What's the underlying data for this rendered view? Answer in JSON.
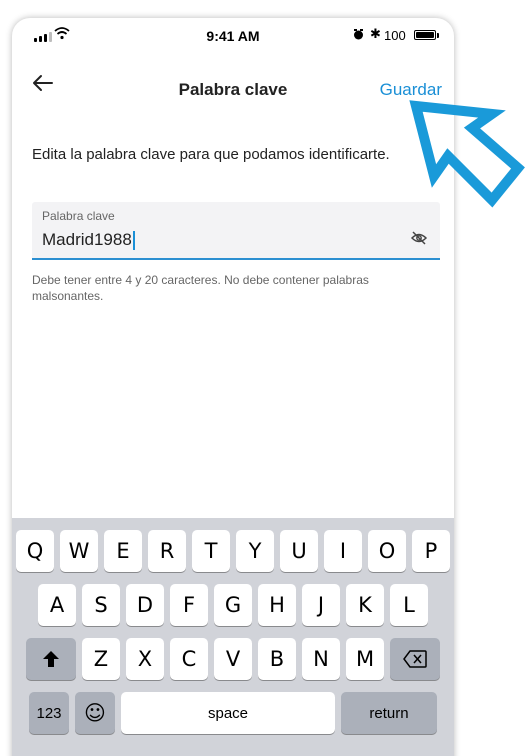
{
  "status_bar": {
    "time": "9:41 AM",
    "battery": "100",
    "bluetooth": "✱"
  },
  "nav": {
    "title": "Palabra clave",
    "save_label": "Guardar"
  },
  "description": "Edita la palabra clave para que podamos identificarte.",
  "field": {
    "label": "Palabra clave",
    "value": "Madrid1988"
  },
  "helper": "Debe tener entre 4 y 20 caracteres. No debe contener palabras malsonantes.",
  "keyboard": {
    "row1": [
      "Q",
      "W",
      "E",
      "R",
      "T",
      "Y",
      "U",
      "I",
      "O",
      "P"
    ],
    "row2": [
      "A",
      "S",
      "D",
      "F",
      "G",
      "H",
      "J",
      "K",
      "L"
    ],
    "row3": [
      "Z",
      "X",
      "C",
      "V",
      "B",
      "N",
      "M"
    ],
    "numbers": "123",
    "emoji": "☺",
    "space": "space",
    "return": "return"
  },
  "colors": {
    "accent": "#1a8fd6",
    "arrow": "#1a9ad9",
    "keyboard_bg": "#d1d3d9"
  }
}
